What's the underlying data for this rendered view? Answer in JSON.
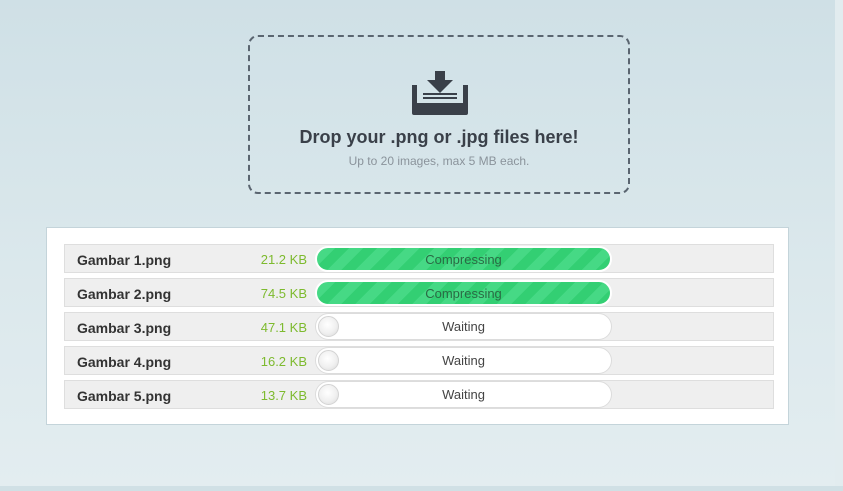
{
  "dropzone": {
    "icon": "download-tray-icon",
    "title": "Drop your .png or .jpg files here!",
    "subtitle": "Up to 20 images, max 5 MB each."
  },
  "colors": {
    "size_text": "#7dba2e",
    "progress_green": "#33cf73",
    "progress_green_light": "#46d985"
  },
  "files": [
    {
      "name": "Gambar 1.png",
      "size": "21.2 KB",
      "status": "Compressing"
    },
    {
      "name": "Gambar 2.png",
      "size": "74.5 KB",
      "status": "Compressing"
    },
    {
      "name": "Gambar 3.png",
      "size": "47.1 KB",
      "status": "Waiting"
    },
    {
      "name": "Gambar 4.png",
      "size": "16.2 KB",
      "status": "Waiting"
    },
    {
      "name": "Gambar 5.png",
      "size": "13.7 KB",
      "status": "Waiting"
    }
  ]
}
